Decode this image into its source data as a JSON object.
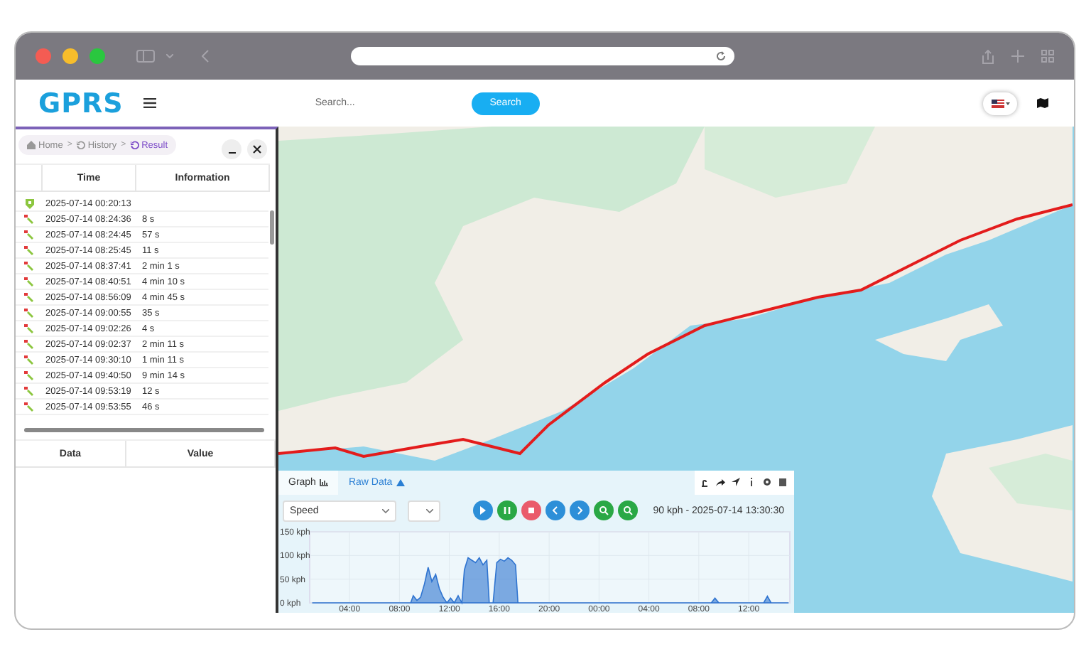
{
  "header": {
    "logo": "GPRS",
    "search": {
      "placeholder": "Search..."
    },
    "search_button": "Search"
  },
  "panel": {
    "breadcrumb_separator": ">",
    "breadcrumb": [
      {
        "label": "Home",
        "kind": "home",
        "selected": false
      },
      {
        "label": "History",
        "kind": "history",
        "selected": false
      },
      {
        "label": "Result",
        "kind": "history",
        "selected": true
      }
    ],
    "columns": [
      "Time",
      "Information"
    ],
    "rows": [
      {
        "kind": "shield",
        "time": "2025-07-14 00:20:13"
      },
      {
        "kind": "flag",
        "time": "2025-07-14 08:24:36",
        "info": "8 s"
      },
      {
        "kind": "flag",
        "time": "2025-07-14 08:24:45",
        "info": "57 s"
      },
      {
        "kind": "flag",
        "time": "2025-07-14 08:25:45",
        "info": "11 s"
      },
      {
        "kind": "flag",
        "time": "2025-07-14 08:37:41",
        "info": "2 min 1 s"
      },
      {
        "kind": "flag",
        "time": "2025-07-14 08:40:51",
        "info": "4 min 10 s"
      },
      {
        "kind": "flag",
        "time": "2025-07-14 08:56:09",
        "info": "4 min 45 s"
      },
      {
        "kind": "flag",
        "time": "2025-07-14 09:00:55",
        "info": "35 s"
      },
      {
        "kind": "flag",
        "time": "2025-07-14 09:02:26",
        "info": "4 s"
      },
      {
        "kind": "flag",
        "time": "2025-07-14 09:02:37",
        "info": "2 min 11 s"
      },
      {
        "kind": "flag",
        "time": "2025-07-14 09:30:10",
        "info": "1 min 11 s"
      },
      {
        "kind": "flag",
        "time": "2025-07-14 09:40:50",
        "info": "9 min 14 s"
      },
      {
        "kind": "flag",
        "time": "2025-07-14 09:53:19",
        "info": "12 s"
      },
      {
        "kind": "flag",
        "time": "2025-07-14 09:53:55",
        "info": "46 s"
      }
    ],
    "detail_columns": [
      "Data",
      "Value"
    ]
  },
  "graph": {
    "tabs": [
      {
        "label": "Graph",
        "kind": "chart",
        "selected": true
      },
      {
        "label": "Raw Data",
        "kind": "warning",
        "selected": false
      }
    ],
    "metric": "Speed",
    "reading": "90 kph - 2025-07-14 13:30:30",
    "chart_data": {
      "type": "area",
      "grid": true,
      "xlim": [
        "2025-07-14T00:48",
        "2025-07-15T15:18"
      ],
      "ylim": [
        0,
        150
      ],
      "yticks": [
        {
          "value": 0,
          "label": "0 kph"
        },
        {
          "value": 50,
          "label": "50 kph"
        },
        {
          "value": 100,
          "label": "100 kph"
        },
        {
          "value": 150,
          "label": "150 kph"
        }
      ],
      "xticks": [
        {
          "value": "2025-07-14T04:00",
          "label": "04:00"
        },
        {
          "value": "2025-07-14T08:00",
          "label": "08:00"
        },
        {
          "value": "2025-07-14T12:00",
          "label": "12:00"
        },
        {
          "value": "2025-07-14T16:00",
          "label": "16:00"
        },
        {
          "value": "2025-07-14T20:00",
          "label": "20:00"
        },
        {
          "value": "2025-07-15T00:00",
          "label": "00:00"
        },
        {
          "value": "2025-07-15T04:00",
          "label": "04:00"
        },
        {
          "value": "2025-07-15T08:00",
          "label": "08:00"
        },
        {
          "value": "2025-07-15T12:00",
          "label": "12:00"
        }
      ],
      "x": [
        "2025-07-14T01:00",
        "2025-07-14T08:54",
        "2025-07-14T09:06",
        "2025-07-14T09:24",
        "2025-07-14T09:42",
        "2025-07-14T10:00",
        "2025-07-14T10:18",
        "2025-07-14T10:36",
        "2025-07-14T10:54",
        "2025-07-14T11:12",
        "2025-07-14T11:30",
        "2025-07-14T11:48",
        "2025-07-14T12:06",
        "2025-07-14T12:24",
        "2025-07-14T12:42",
        "2025-07-14T13:00",
        "2025-07-14T13:12",
        "2025-07-14T13:30",
        "2025-07-14T13:48",
        "2025-07-14T14:06",
        "2025-07-14T14:24",
        "2025-07-14T14:42",
        "2025-07-14T15:00",
        "2025-07-14T15:12",
        "2025-07-14T15:30",
        "2025-07-14T15:48",
        "2025-07-14T16:06",
        "2025-07-14T16:24",
        "2025-07-14T16:42",
        "2025-07-14T17:00",
        "2025-07-14T17:18",
        "2025-07-14T17:30",
        "2025-07-15T09:00",
        "2025-07-15T09:18",
        "2025-07-15T09:36",
        "2025-07-15T13:12",
        "2025-07-15T13:30",
        "2025-07-15T13:48",
        "2025-07-15T15:12"
      ],
      "series": [
        {
          "color": "#2f74d0",
          "values": [
            0,
            0,
            15,
            5,
            12,
            40,
            75,
            45,
            60,
            30,
            12,
            0,
            10,
            0,
            15,
            0,
            70,
            95,
            90,
            85,
            95,
            80,
            90,
            0,
            0,
            85,
            92,
            88,
            95,
            90,
            80,
            0,
            0,
            10,
            0,
            0,
            14,
            0,
            0
          ]
        }
      ]
    }
  }
}
